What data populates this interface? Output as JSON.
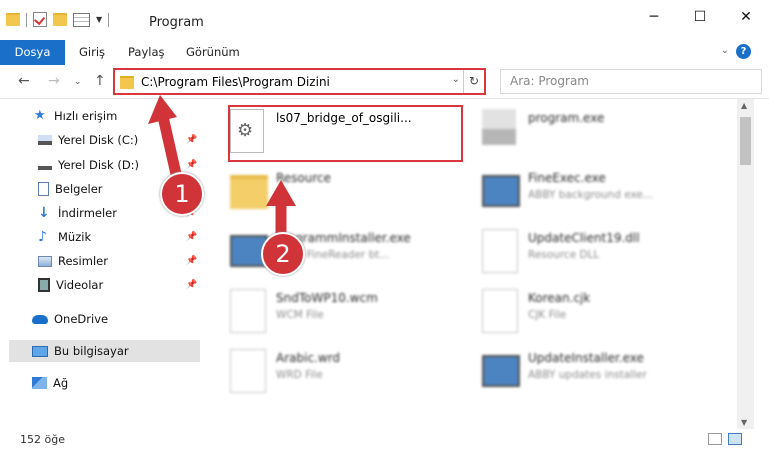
{
  "window": {
    "title": "Program"
  },
  "ribbon": {
    "tabs": [
      "Dosya",
      "Giriş",
      "Paylaş",
      "Görünüm"
    ]
  },
  "address": {
    "path": "C:\\Program Files\\Program Dizini",
    "search_placeholder": "Ara: Program"
  },
  "sidebar": {
    "items": [
      {
        "label": "Hızlı erişim",
        "icon": "star-icon"
      },
      {
        "label": "Yerel Disk (C:)",
        "icon": "drive-icon"
      },
      {
        "label": "Yerel Disk (D:)",
        "icon": "drive-icon"
      },
      {
        "label": "Belgeler",
        "icon": "documents-icon"
      },
      {
        "label": "İndirmeler",
        "icon": "download-icon"
      },
      {
        "label": "Müzik",
        "icon": "music-icon"
      },
      {
        "label": "Resimler",
        "icon": "pictures-icon"
      },
      {
        "label": "Videolar",
        "icon": "video-icon"
      },
      {
        "label": "OneDrive",
        "icon": "cloud-icon"
      },
      {
        "label": "Bu bilgisayar",
        "icon": "computer-icon"
      },
      {
        "label": "Ağ",
        "icon": "network-icon"
      }
    ]
  },
  "files": [
    {
      "name": "ls07_bridge_of_osgili...",
      "type": ""
    },
    {
      "name": "program.exe",
      "type": ""
    },
    {
      "name": "Resource",
      "type": ""
    },
    {
      "name": "FineExec.exe",
      "type": "ABBY background exe..."
    },
    {
      "name": "ProgrammInstaller.exe",
      "type": "ABBY FineReader bt..."
    },
    {
      "name": "UpdateClient19.dll",
      "type": "Resource DLL"
    },
    {
      "name": "SndToWP10.wcm",
      "type": "WCM File"
    },
    {
      "name": "Korean.cjk",
      "type": "CJK File"
    },
    {
      "name": "Arabic.wrd",
      "type": "WRD File"
    },
    {
      "name": "UpdateInstaller.exe",
      "type": "ABBY updates installer"
    }
  ],
  "status": {
    "count": "152 öğe"
  },
  "annotations": {
    "badge1": "1",
    "badge2": "2"
  },
  "colors": {
    "accent": "#1a6fc9",
    "highlight": "#d9363e"
  }
}
